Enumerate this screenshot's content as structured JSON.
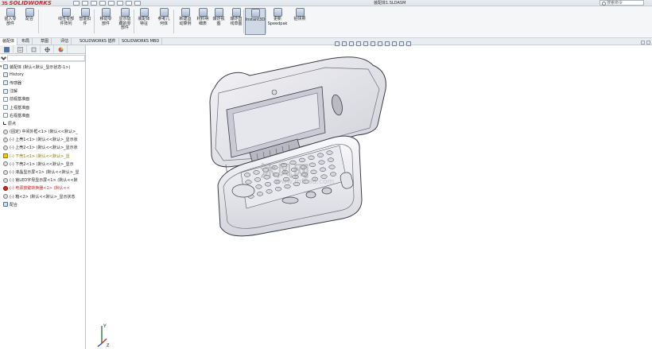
{
  "app": {
    "brand_ds": "3S",
    "brand_name": "SOLIDWORKS",
    "document_title": "装配体1.SLDASM",
    "search_placeholder": "搜索命令"
  },
  "ribbon": {
    "tools": [
      {
        "label": "插入零\n部件",
        "icon": "insert-components-icon"
      },
      {
        "label": "配合",
        "icon": "mate-icon"
      },
      {
        "label": "线性零部\n件阵列",
        "icon": "linear-pattern-icon"
      },
      {
        "label": "智能扣\n件",
        "icon": "smart-fasteners-icon"
      },
      {
        "label": "移动零\n部件",
        "icon": "move-component-icon"
      },
      {
        "label": "显示隐\n藏的零\n部件",
        "icon": "show-hidden-icon"
      },
      {
        "label": "装配体\n特征",
        "icon": "assembly-features-icon"
      },
      {
        "label": "参考几\n何体",
        "icon": "reference-geometry-icon"
      },
      {
        "label": "新建运\n动算例",
        "icon": "motion-study-icon"
      },
      {
        "label": "材料明\n细表",
        "icon": "bom-icon"
      },
      {
        "label": "爆炸视\n图",
        "icon": "exploded-view-icon"
      },
      {
        "label": "爆炸直\n线草图",
        "icon": "explode-line-icon"
      },
      {
        "label": "Instant3D",
        "icon": "instant3d-icon"
      },
      {
        "label": "更新\nSpeedpak",
        "icon": "speedpak-icon"
      },
      {
        "label": "拍快照",
        "icon": "snapshot-icon"
      }
    ]
  },
  "command_tabs": [
    "装配体",
    "布局",
    "草图",
    "评估",
    "SOLIDWORKS 插件",
    "SOLIDWORKS MBD"
  ],
  "feature_tree": {
    "root": "装配体 (默认<默认_显示状态-1>)",
    "items": [
      {
        "text": "History",
        "icon": "history"
      },
      {
        "text": "传感器",
        "icon": "sensor"
      },
      {
        "text": "注解",
        "icon": "annotation"
      },
      {
        "text": "前视基准面",
        "icon": "plane"
      },
      {
        "text": "上视基准面",
        "icon": "plane"
      },
      {
        "text": "右视基准面",
        "icon": "plane"
      },
      {
        "text": "原点",
        "icon": "origin"
      },
      {
        "text": "(固定) 中间外框<1> (默认<<默认>_",
        "icon": "part"
      },
      {
        "text": "(-) 上壳1<1> (默认<<默认>_显示状",
        "icon": "part"
      },
      {
        "text": "(-) 上壳2<1> (默认<<默认>_显示状",
        "icon": "part"
      },
      {
        "text": "(-) 下壳1<1> (默认<<默认>_显",
        "icon": "warn"
      },
      {
        "text": "(-) 下壳2<1> (默认<<默认>_显示",
        "icon": "part"
      },
      {
        "text": "(-) 液晶显示屏<1> (默认<<默认>_显",
        "icon": "part"
      },
      {
        "text": "(-) 锁LED字母显示屏<1> (默认<<默",
        "icon": "part"
      },
      {
        "text": "(-) 电源按键转换器<1> (默认<<",
        "icon": "err"
      },
      {
        "text": "(-) 箱<2> (默认<<默认>_显示状态",
        "icon": "part"
      },
      {
        "text": "配合",
        "icon": "mate"
      }
    ]
  },
  "watermark": {
    "main": "沐风网",
    "sub": "www.mfcad.com"
  },
  "triad_labels": {
    "y": "Y",
    "z": "Z"
  }
}
